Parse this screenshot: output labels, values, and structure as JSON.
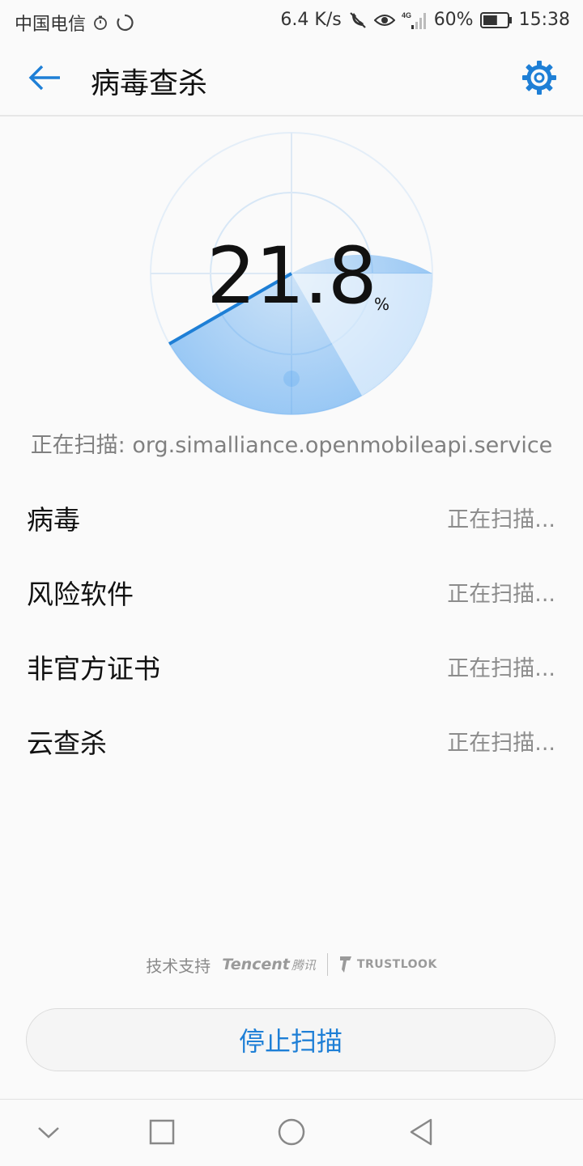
{
  "status_bar": {
    "carrier": "中国电信",
    "net_speed": "6.4 K/s",
    "network_type": "4G",
    "battery": "60%",
    "battery_level": 0.6,
    "time": "15:38"
  },
  "app_bar": {
    "title": "病毒查杀",
    "back_icon": "arrow-left-icon",
    "settings_icon": "gear-icon"
  },
  "progress": {
    "value": "21.8",
    "unit": "%",
    "fraction": 0.218
  },
  "scan_target": "正在扫描: org.simalliance.openmobileapi.service",
  "scan_items": [
    {
      "name": "病毒",
      "status": "正在扫描..."
    },
    {
      "name": "风险软件",
      "status": "正在扫描..."
    },
    {
      "name": "非官方证书",
      "status": "正在扫描..."
    },
    {
      "name": "云查杀",
      "status": "正在扫描..."
    }
  ],
  "credit": {
    "label": "技术支持",
    "brand_tencent": "Tencent",
    "brand_tencent_cn": "腾讯",
    "brand_trustlook": "TRUSTLOOK"
  },
  "stop_button": "停止扫描",
  "colors": {
    "accent": "#1e7fd6",
    "radar_fill": "#4a9ff0",
    "text_secondary": "#8c8c8c"
  },
  "nav_icons": [
    "chevron-down-icon",
    "square-recents-icon",
    "circle-home-icon",
    "triangle-back-icon"
  ]
}
